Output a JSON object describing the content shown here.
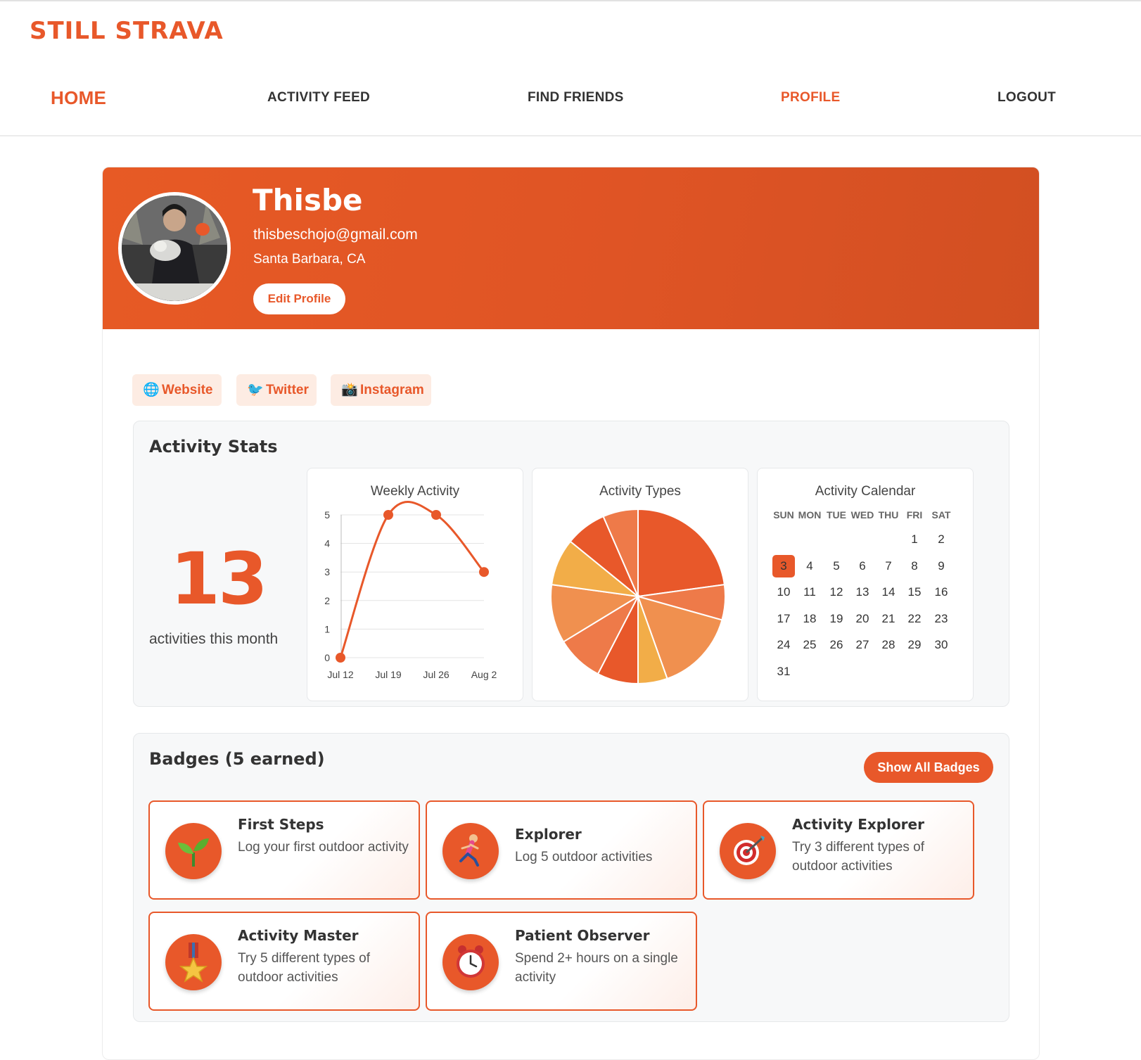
{
  "app": {
    "logo": "STILL STRAVA"
  },
  "nav": {
    "home": "HOME",
    "feed": "ACTIVITY FEED",
    "friends": "FIND FRIENDS",
    "profile": "PROFILE",
    "logout": "LOGOUT"
  },
  "profile": {
    "name": "Thisbe",
    "email": "thisbeschojo@gmail.com",
    "location": "Santa Barbara, CA",
    "edit_label": "Edit Profile",
    "banner_color": "#e4562a"
  },
  "social": [
    {
      "icon": "globe-icon",
      "label": "Website"
    },
    {
      "icon": "bird-icon",
      "label": "Twitter"
    },
    {
      "icon": "camera-icon",
      "label": "Instagram"
    }
  ],
  "stats": {
    "title": "Activity Stats",
    "count": "13",
    "count_label": "activities this month"
  },
  "chart_data": [
    {
      "type": "line",
      "title": "Weekly Activity",
      "categories": [
        "Jul 12",
        "Jul 19",
        "Jul 26",
        "Aug 2"
      ],
      "values": [
        0,
        5,
        5,
        3
      ],
      "ylim": [
        0,
        5
      ],
      "yticks": [
        "0",
        "1",
        "2",
        "3",
        "4",
        "5"
      ],
      "grid": true,
      "color": "#e8582a"
    },
    {
      "type": "pie",
      "title": "Activity Types",
      "values": [
        21,
        6,
        14,
        5,
        7,
        8,
        10,
        8,
        7,
        6
      ],
      "colors": [
        "#e8582a",
        "#ee7a49",
        "#f0904f",
        "#f2ad48",
        "#e8582a",
        "#ee7a49",
        "#f0904f",
        "#f2ad48",
        "#e8582a",
        "#ee7a49"
      ]
    }
  ],
  "calendar": {
    "title": "Activity Calendar",
    "weekdays": [
      "SUN",
      "MON",
      "TUE",
      "WED",
      "THU",
      "FRI",
      "SAT"
    ],
    "first_weekday": 5,
    "days_in_month": 31,
    "highlight_day": 3
  },
  "badges": {
    "title": "Badges (5 earned)",
    "show_all_label": "Show All Badges",
    "items": [
      {
        "icon": "seedling-icon",
        "title": "First Steps",
        "desc": "Log your first outdoor activity"
      },
      {
        "icon": "runner-icon",
        "title": "Explorer",
        "desc": "Log 5 outdoor activities"
      },
      {
        "icon": "target-icon",
        "title": "Activity Explorer",
        "desc": "Try 3 different types of outdoor activities"
      },
      {
        "icon": "medal-icon",
        "title": "Activity Master",
        "desc": "Try 5 different types of outdoor activities"
      },
      {
        "icon": "alarm-clock-icon",
        "title": "Patient Observer",
        "desc": "Spend 2+ hours on a single activity"
      }
    ]
  }
}
